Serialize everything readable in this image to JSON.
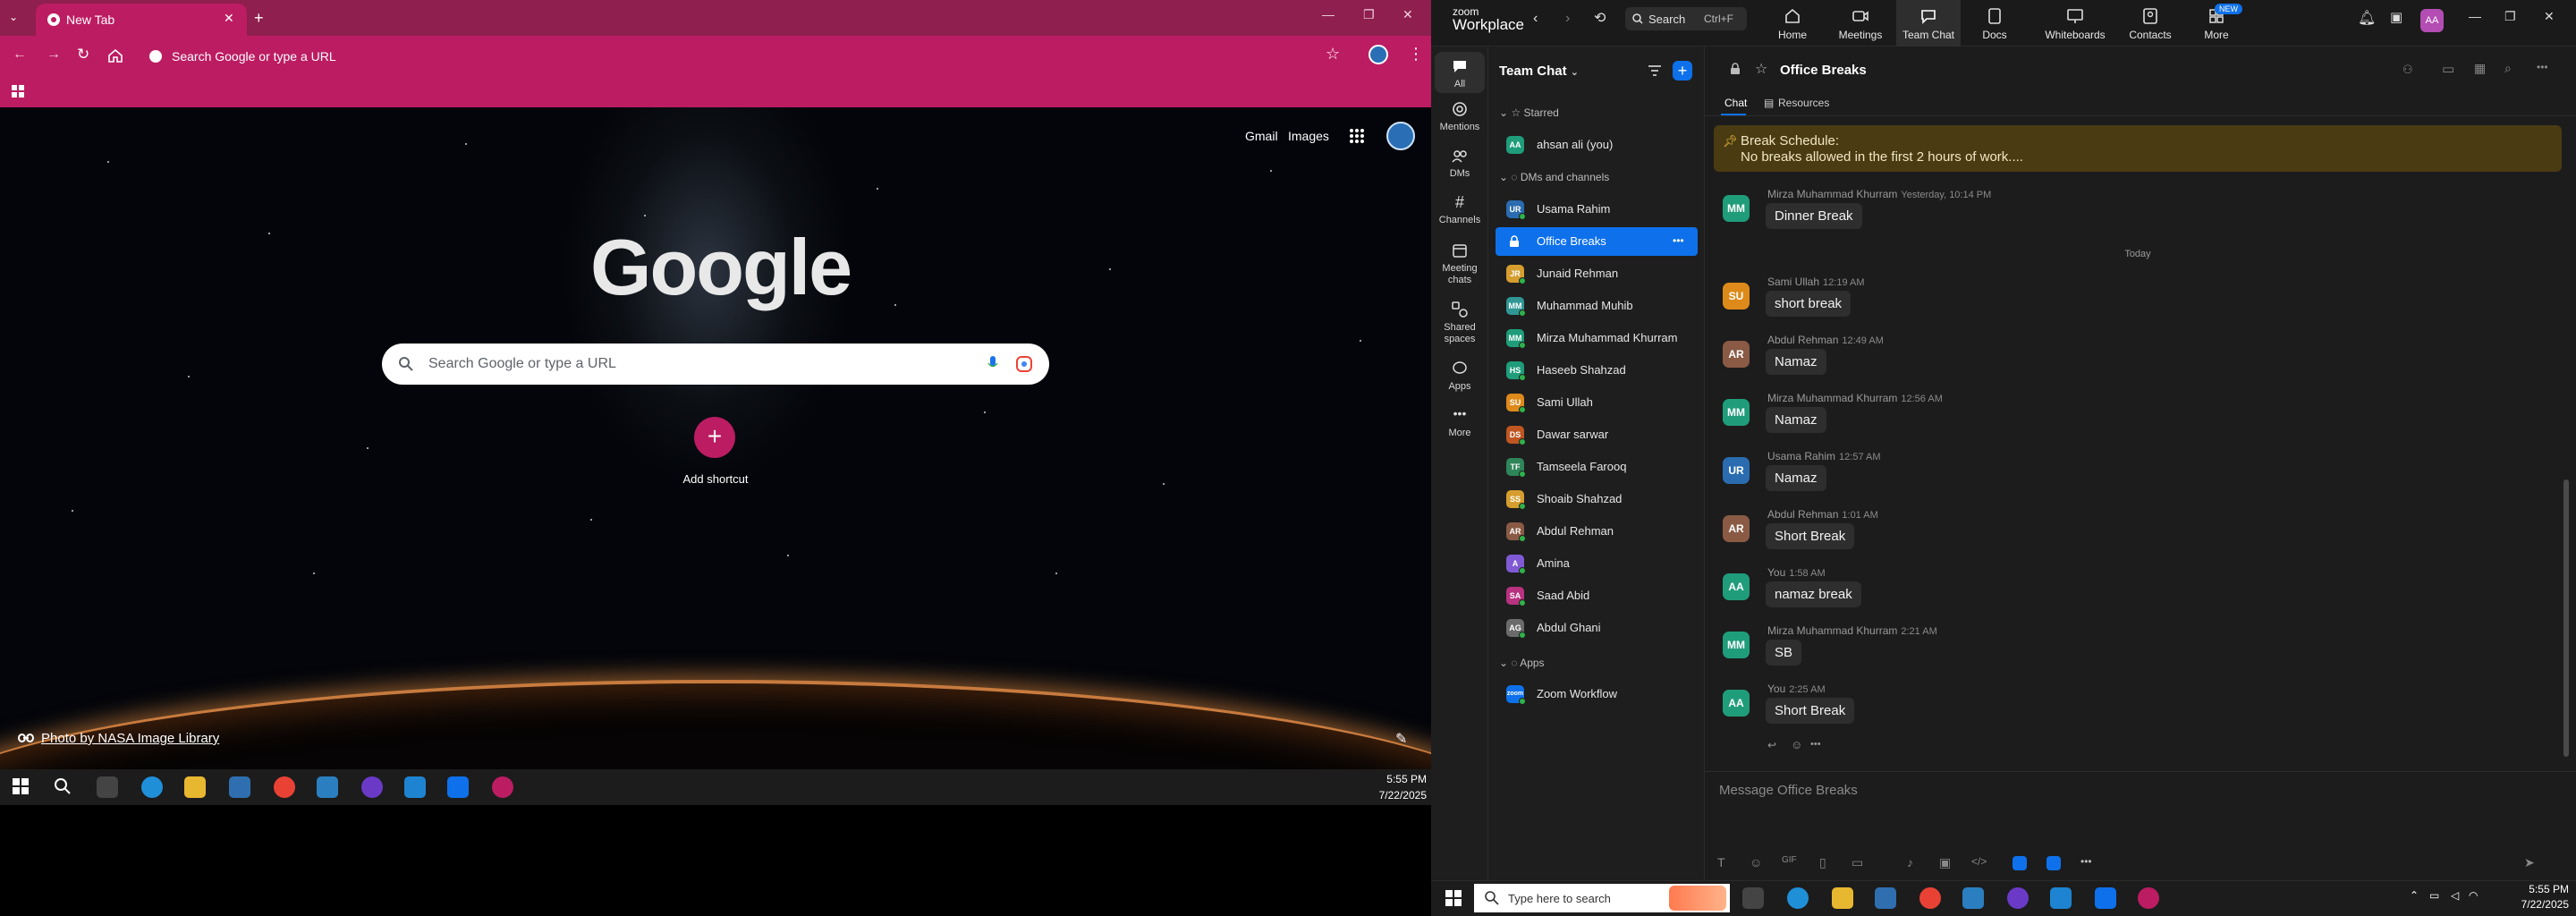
{
  "chrome": {
    "tab_title": "New Tab",
    "omnibox_placeholder": "Search Google or type a URL",
    "ntp": {
      "links": [
        "Gmail",
        "Images"
      ],
      "logo_text": "Google",
      "search_placeholder": "Search Google or type a URL",
      "add_shortcut": "Add shortcut",
      "add_shortcut_glyph": "+",
      "photo_credit": "Photo by NASA Image Library"
    },
    "colors": {
      "frame": "#8e1f4e",
      "toolbar": "#bc1c62"
    }
  },
  "taskbar_left": {
    "time": "5:55 PM",
    "date": "7/22/2025"
  },
  "zoom": {
    "logo_top": "zoom",
    "logo_bottom": "Workplace",
    "search_label": "Search",
    "search_shortcut": "Ctrl+F",
    "nav": [
      "Home",
      "Meetings",
      "Team Chat",
      "Docs",
      "Whiteboards",
      "Contacts",
      "More"
    ],
    "new_badge": "NEW",
    "user_initials": "AA",
    "rail": [
      "All",
      "Mentions",
      "DMs",
      "Channels",
      "Meeting chats",
      "Shared spaces",
      "Apps",
      "More"
    ],
    "list_title": "Team Chat",
    "sections": {
      "starred": "Starred",
      "dms": "DMs and channels",
      "apps": "Apps"
    },
    "starred": [
      {
        "initials": "AA",
        "name": "ahsan ali (you)",
        "color": "#1f9d7a"
      }
    ],
    "dms": [
      {
        "initials": "UR",
        "name": "Usama Rahim",
        "color": "#2b6cb0"
      },
      {
        "initials": "",
        "name": "Office Breaks",
        "color": "#0e71eb"
      },
      {
        "initials": "JR",
        "name": "Junaid Rehman",
        "color": "#d69e2e"
      },
      {
        "initials": "MM",
        "name": "Muhammad Muhib",
        "color": "#319795"
      },
      {
        "initials": "MM",
        "name": "Mirza Muhammad Khurram",
        "color": "#1f9d7a"
      },
      {
        "initials": "HS",
        "name": "Haseeb Shahzad",
        "color": "#1f9d7a"
      },
      {
        "initials": "SU",
        "name": "Sami Ullah",
        "color": "#dd8a1a"
      },
      {
        "initials": "DS",
        "name": "Dawar sarwar",
        "color": "#c05621"
      },
      {
        "initials": "TF",
        "name": "Tamseela Farooq",
        "color": "#2f855a"
      },
      {
        "initials": "SS",
        "name": "Shoaib Shahzad",
        "color": "#d69e2e"
      },
      {
        "initials": "AR",
        "name": "Abdul Rehman",
        "color": "#8a5a44"
      },
      {
        "initials": "A",
        "name": "Amina",
        "color": "#805ad5"
      },
      {
        "initials": "SA",
        "name": "Saad Abid",
        "color": "#b83280"
      },
      {
        "initials": "AG",
        "name": "Abdul Ghani",
        "color": "#6b6b6b"
      }
    ],
    "apps": [
      {
        "initials": "zoom",
        "name": "Zoom Workflow",
        "color": "#0e71eb"
      }
    ],
    "channel": {
      "title": "Office Breaks",
      "tabs": [
        "Chat",
        "Resources"
      ],
      "pinned_line1": "Break Schedule:",
      "pinned_line2": "No breaks allowed in the first 2 hours of work....",
      "date_separator": "Today",
      "messages": [
        {
          "initials": "MM",
          "color": "#1f9d7a",
          "author": "Mirza Muhammad Khurram",
          "time": "Yesterday, 10:14 PM",
          "text": "Dinner Break"
        },
        {
          "initials": "SU",
          "color": "#dd8a1a",
          "author": "Sami Ullah",
          "time": "12:19 AM",
          "text": "short break"
        },
        {
          "initials": "AR",
          "color": "#8a5a44",
          "author": "Abdul Rehman",
          "time": "12:49 AM",
          "text": "Namaz"
        },
        {
          "initials": "MM",
          "color": "#1f9d7a",
          "author": "Mirza Muhammad Khurram",
          "time": "12:56 AM",
          "text": "Namaz"
        },
        {
          "initials": "UR",
          "color": "#2b6cb0",
          "author": "Usama Rahim",
          "time": "12:57 AM",
          "text": "Namaz"
        },
        {
          "initials": "AR",
          "color": "#8a5a44",
          "author": "Abdul Rehman",
          "time": "1:01 AM",
          "text": "Short Break"
        },
        {
          "initials": "AA",
          "color": "#1f9d7a",
          "author": "You",
          "time": "1:58 AM",
          "text": "namaz break"
        },
        {
          "initials": "MM",
          "color": "#1f9d7a",
          "author": "Mirza Muhammad Khurram",
          "time": "2:21 AM",
          "text": "SB"
        },
        {
          "initials": "AA",
          "color": "#1f9d7a",
          "author": "You",
          "time": "2:25 AM",
          "text": "Short Break"
        }
      ],
      "composer_placeholder": "Message Office Breaks"
    }
  },
  "taskbar_right": {
    "search_placeholder": "Type here to search",
    "time": "5:55 PM",
    "date": "7/22/2025"
  }
}
